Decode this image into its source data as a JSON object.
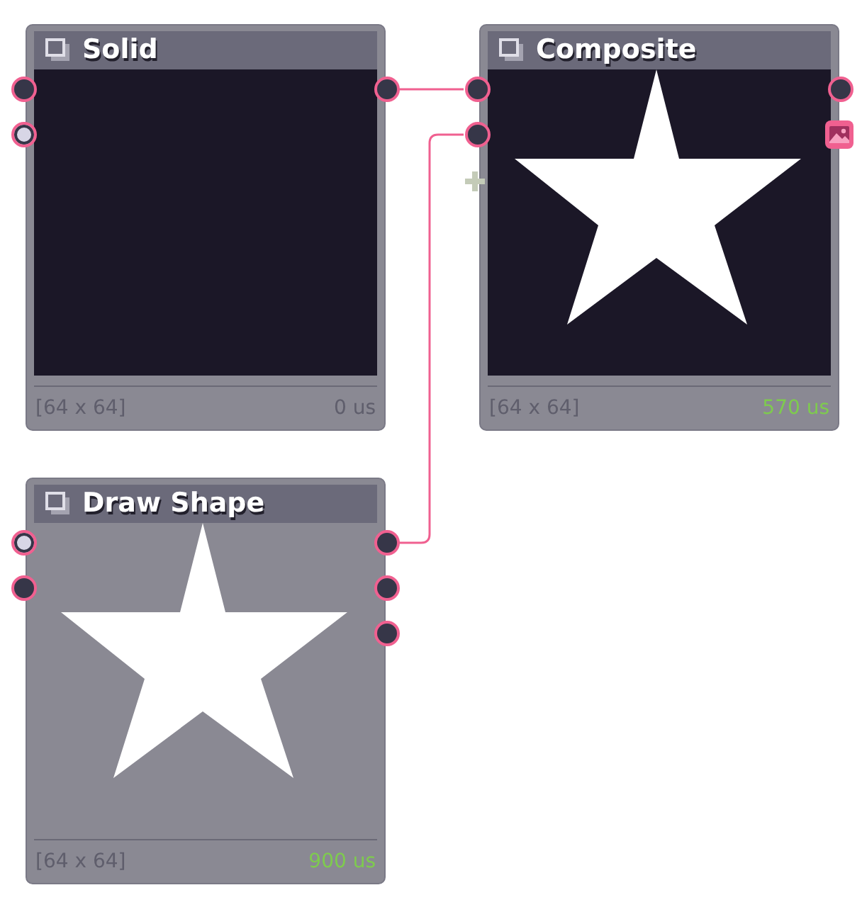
{
  "nodes": [
    {
      "title": "Solid",
      "preview": {
        "dark": true,
        "star": false
      },
      "can_add_input": false,
      "size": "[64 x 64]",
      "time": "0 us",
      "time_highlighted": false,
      "inputs": [
        {
          "kind": "dark"
        },
        {
          "kind": "light"
        }
      ],
      "outputs": [
        {
          "kind": "port"
        }
      ]
    },
    {
      "title": "Composite",
      "preview": {
        "dark": true,
        "star": true
      },
      "can_add_input": true,
      "size": "[64 x 64]",
      "time": "570 us",
      "time_highlighted": true,
      "inputs": [
        {
          "kind": "dark"
        },
        {
          "kind": "dark"
        }
      ],
      "outputs": [
        {
          "kind": "port"
        },
        {
          "kind": "image"
        }
      ]
    },
    {
      "title": "Draw Shape",
      "preview": {
        "dark": false,
        "star": true
      },
      "can_add_input": false,
      "size": "[64 x 64]",
      "time": "900 us",
      "time_highlighted": true,
      "inputs": [
        {
          "kind": "light"
        },
        {
          "kind": "dark"
        }
      ],
      "outputs": [
        {
          "kind": "port"
        },
        {
          "kind": "port"
        },
        {
          "kind": "port"
        }
      ]
    }
  ]
}
